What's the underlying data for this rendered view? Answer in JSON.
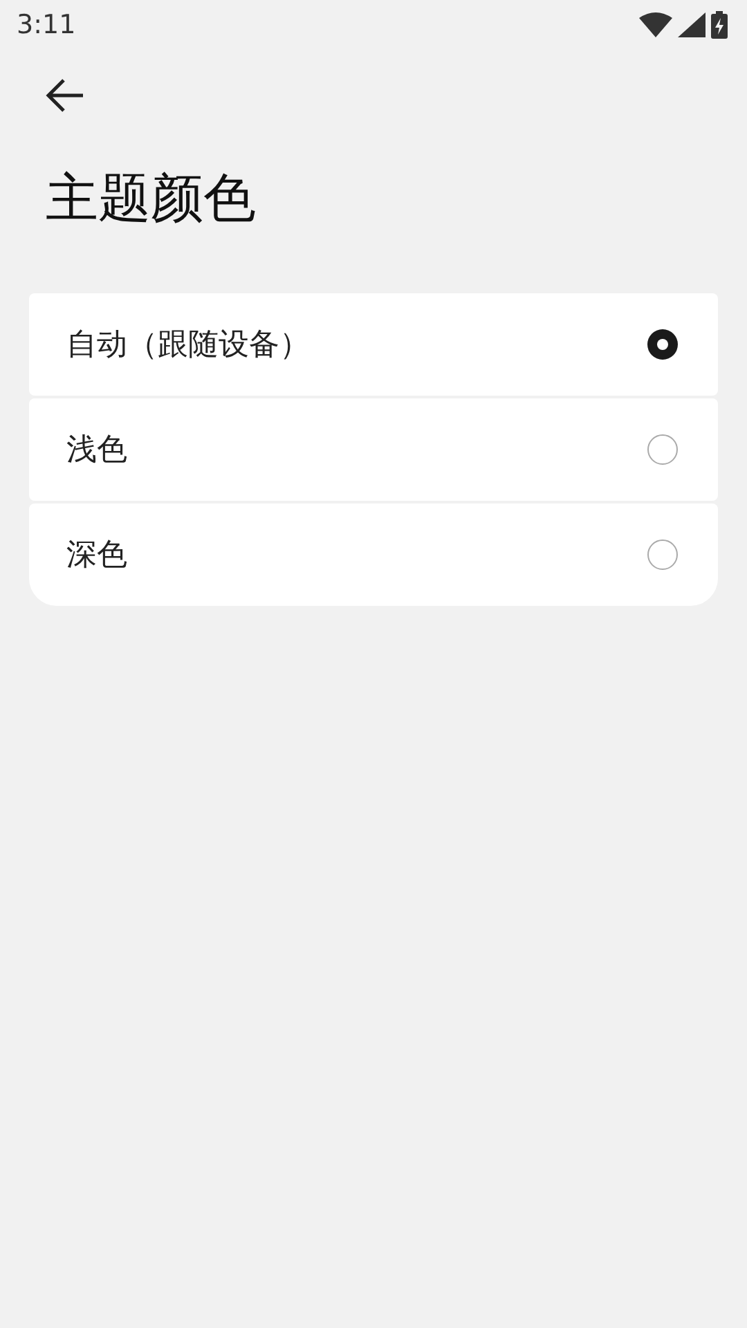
{
  "status_bar": {
    "time": "3:11"
  },
  "title": "主题颜色",
  "options": [
    {
      "label": "自动（跟随设备）",
      "selected": true
    },
    {
      "label": "浅色",
      "selected": false
    },
    {
      "label": "深色",
      "selected": false
    }
  ]
}
